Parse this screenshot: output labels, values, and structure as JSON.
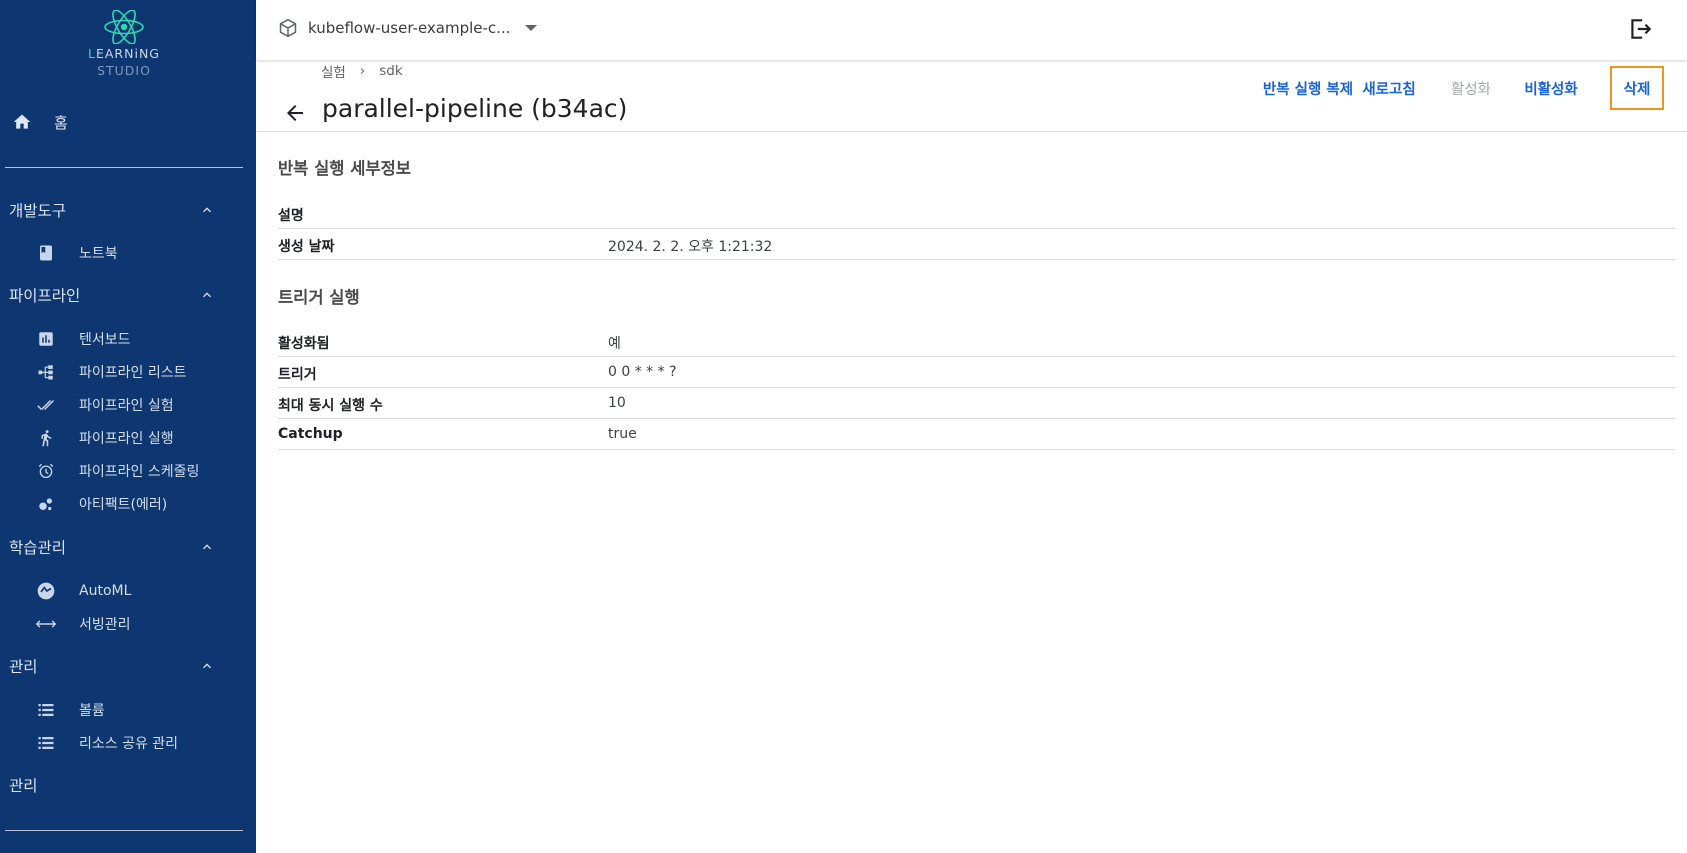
{
  "app": {
    "logo_line1": "LEARNiNG",
    "logo_line2": "STUDIO",
    "brand_accent": "#2fe0a8",
    "sidebar_bg": "#0e3670"
  },
  "sidebar": {
    "home": {
      "label": "홈",
      "icon": "home-icon"
    },
    "sections": [
      {
        "label": "개발도구",
        "items": [
          {
            "label": "노트북",
            "icon": "book-icon"
          }
        ]
      },
      {
        "label": "파이프라인",
        "items": [
          {
            "label": "텐서보드",
            "icon": "bar-chart-icon"
          },
          {
            "label": "파이프라인 리스트",
            "icon": "pipeline-icon"
          },
          {
            "label": "파이프라인 실험",
            "icon": "double-check-icon"
          },
          {
            "label": "파이프라인 실행",
            "icon": "run-icon"
          },
          {
            "label": "파이프라인 스케줄링",
            "icon": "alarm-icon"
          },
          {
            "label": "아티팩트(에러)",
            "icon": "bubbles-icon"
          }
        ]
      },
      {
        "label": "학습관리",
        "items": [
          {
            "label": "AutoML",
            "icon": "automl-icon"
          },
          {
            "label": "서빙관리",
            "icon": "arrows-icon"
          }
        ]
      },
      {
        "label": "관리",
        "items": [
          {
            "label": "볼륨",
            "icon": "list-icon"
          },
          {
            "label": "리소스 공유 관리",
            "icon": "list-icon"
          }
        ]
      }
    ],
    "bottom_label": "관리"
  },
  "header": {
    "namespace": "kubeflow-user-example-c...",
    "namespace_icon": "cube-icon",
    "logout_icon": "logout-icon"
  },
  "page": {
    "breadcrumbs": [
      "실험",
      "sdk"
    ],
    "breadcrumb_sep": "›",
    "title": "parallel-pipeline (b34ac)",
    "actions": [
      {
        "label": "반복 실행 복제",
        "enabled": true
      },
      {
        "label": "새로고침",
        "enabled": true
      },
      {
        "label": "활성화",
        "enabled": false
      },
      {
        "label": "비활성화",
        "enabled": true
      },
      {
        "label": "삭제",
        "enabled": true,
        "focused": true
      }
    ]
  },
  "details": {
    "heading": "반복 실행 세부정보",
    "rows": [
      {
        "key": "설명",
        "value": ""
      },
      {
        "key": "생성 날짜",
        "value": "2024. 2. 2. 오후 1:21:32"
      }
    ]
  },
  "trigger": {
    "heading": "트리거 실행",
    "rows": [
      {
        "key": "활성화됨",
        "value": "예"
      },
      {
        "key": "트리거",
        "value": "0 0 * * * ?"
      },
      {
        "key": "최대 동시 실행 수",
        "value": "10"
      },
      {
        "key": "Catchup",
        "value": "true"
      }
    ]
  },
  "colors": {
    "link": "#1a63d6",
    "disabled": "#a6a8ad",
    "focus_outline": "#f0921e"
  }
}
